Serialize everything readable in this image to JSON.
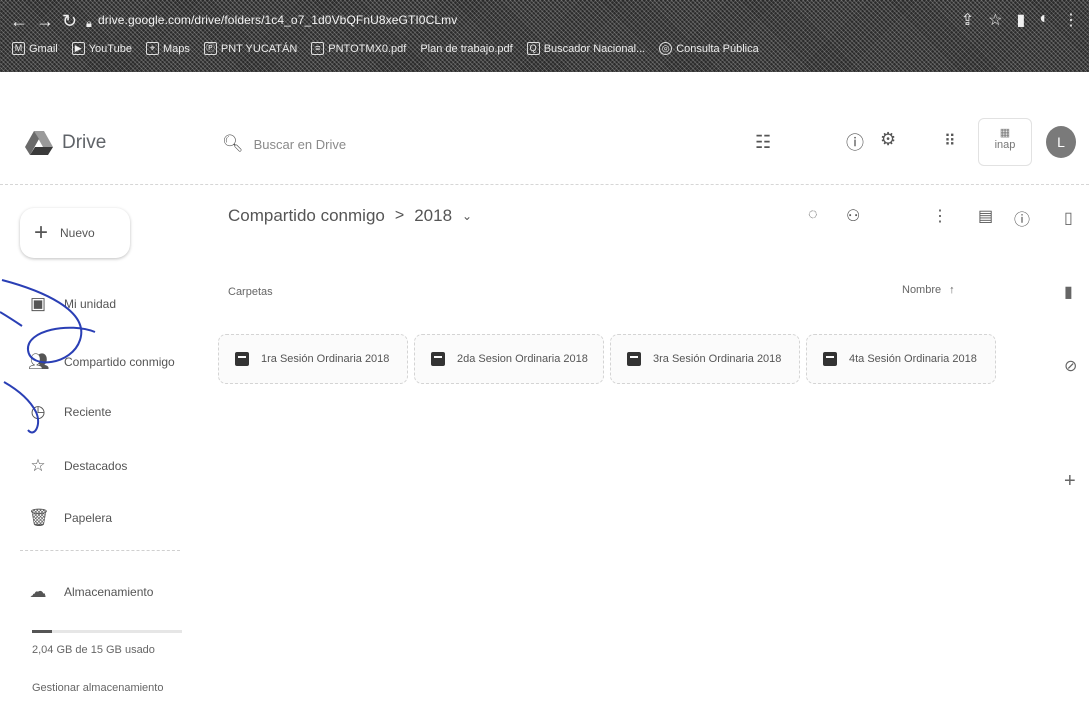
{
  "browser": {
    "url": "drive.google.com/drive/folders/1c4_o7_1d0VbQFnU8xeGTI0CLmv",
    "bookmarks": [
      {
        "label": "Gmail",
        "icon": "gmail-icon"
      },
      {
        "label": "YouTube",
        "icon": "youtube-icon"
      },
      {
        "label": "Maps",
        "icon": "maps-icon"
      },
      {
        "label": "PNT YUCATÁN",
        "icon": "pnt-icon"
      },
      {
        "label": "PNTOTMX0.pdf",
        "icon": "pdf-icon"
      },
      {
        "label": "Plan de trabajo.pdf",
        "icon": "pdf-icon"
      },
      {
        "label": "Buscador Nacional...",
        "icon": "search-site-icon"
      },
      {
        "label": "Consulta Pública",
        "icon": "globe-icon"
      }
    ]
  },
  "header": {
    "app_name": "Drive",
    "search_placeholder": "Buscar en Drive",
    "org_badge": "inap",
    "avatar_letter": "L"
  },
  "sidebar": {
    "new_label": "Nuevo",
    "items": [
      {
        "label": "Mi unidad",
        "icon": "my-drive-icon"
      },
      {
        "label": "Compartido conmigo",
        "icon": "shared-icon"
      },
      {
        "label": "Reciente",
        "icon": "clock-icon"
      },
      {
        "label": "Destacados",
        "icon": "star-icon"
      },
      {
        "label": "Papelera",
        "icon": "trash-icon"
      }
    ],
    "storage_label": "Almacenamiento",
    "storage_used_text": "2,04 GB de 15 GB usado",
    "storage_fraction": 0.136,
    "manage_storage": "Gestionar almacenamiento"
  },
  "main": {
    "breadcrumb_root": "Compartido conmigo",
    "breadcrumb_separator": ">",
    "breadcrumb_current": "2018",
    "section_label": "Carpetas",
    "sort_label": "Nombre",
    "sort_arrow": "↑",
    "folders": [
      "1ra Sesión Ordinaria 2018",
      "2da Sesion Ordinaria 2018",
      "3ra Sesión Ordinaria 2018",
      "4ta Sesión Ordinaria 2018"
    ]
  }
}
